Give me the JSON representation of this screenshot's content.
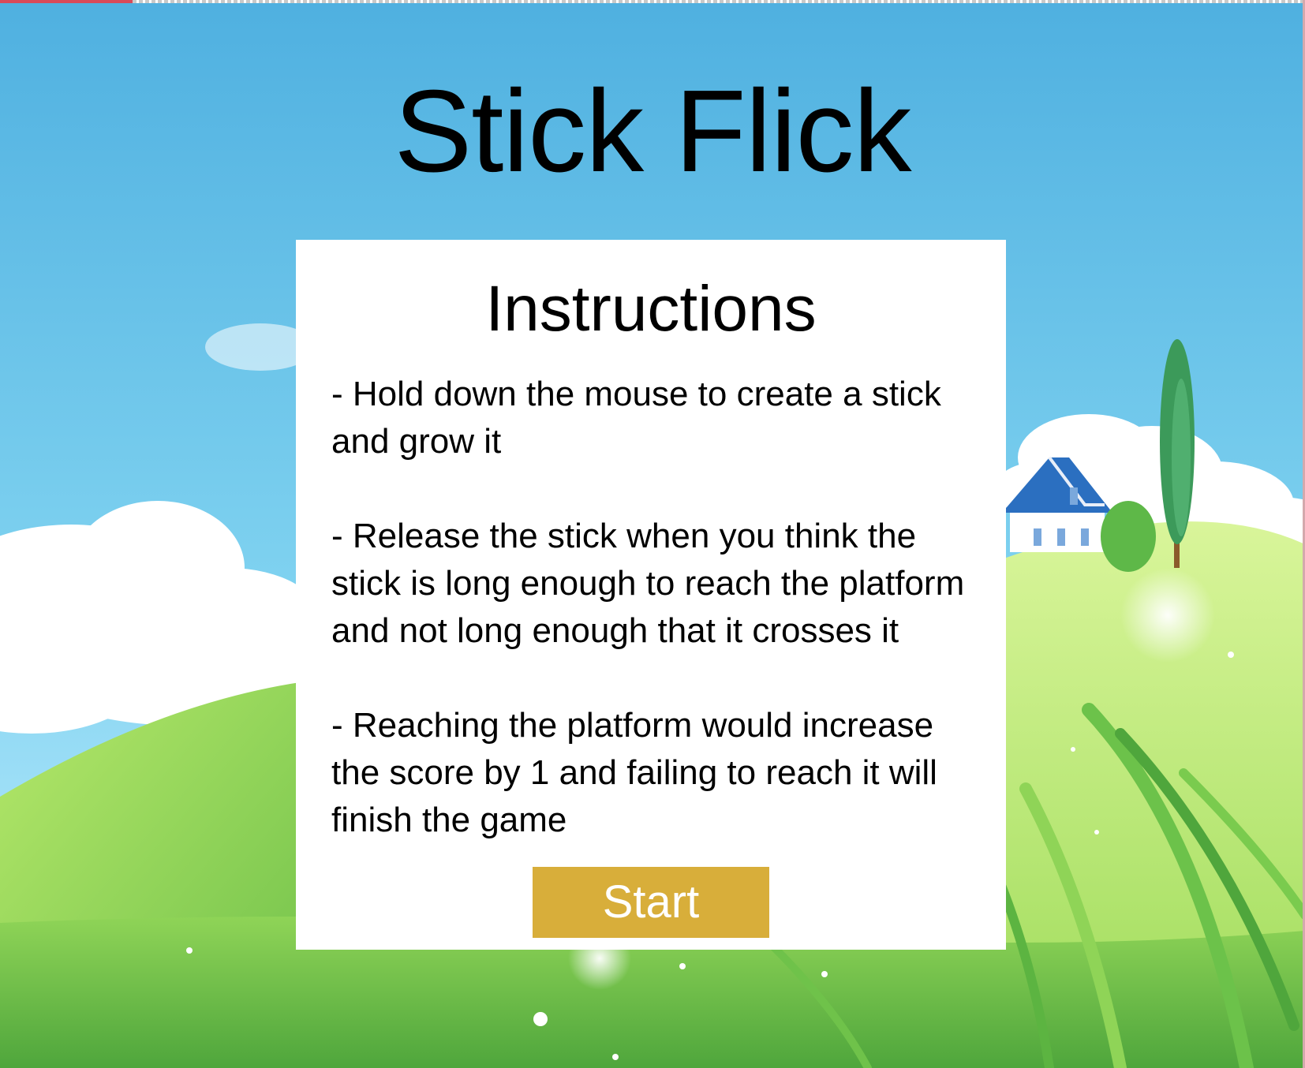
{
  "game": {
    "title": "Stick Flick"
  },
  "instructions": {
    "heading": "Instructions",
    "items": [
      "- Hold down the mouse to create a stick and grow it",
      "- Release the stick when you think the stick is long enough to reach the platform and not long enough that it crosses it",
      "- Reaching the platform would increase the score by 1 and failing to reach it will finish the game"
    ],
    "start_label": "Start"
  },
  "colors": {
    "sky_top": "#4fb2e2",
    "sky_bottom": "#a8e6f7",
    "grass_light": "#c8ee7a",
    "grass_dark": "#5db245",
    "start_button": "#d8ae3a",
    "panel": "#ffffff",
    "house_roof": "#2b6fc0"
  }
}
